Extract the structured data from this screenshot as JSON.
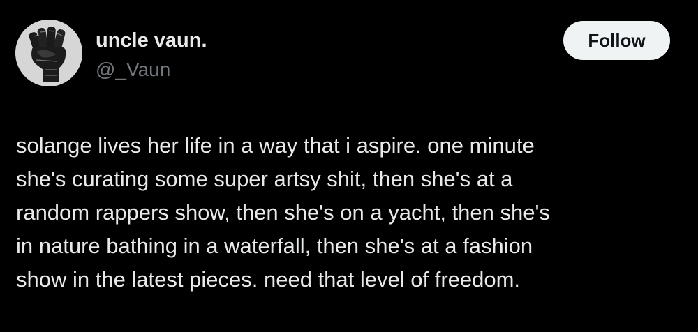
{
  "author": {
    "display_name": "uncle vaun.",
    "handle": "@_Vaun",
    "avatar_icon": "raised-fist-icon"
  },
  "follow_button": {
    "label": "Follow"
  },
  "tweet": {
    "lines": [
      "solange lives her life in a way that i aspire. one minute",
      "she's curating some super artsy shit, then she's at a",
      "random rappers show, then she's on a yacht, then she's",
      "in nature bathing in a waterfall, then she's at a fashion",
      "show in the latest pieces. need that level of freedom."
    ]
  },
  "colors": {
    "background": "#000000",
    "text_primary": "#e7e9ea",
    "text_secondary": "#71767b",
    "follow_bg": "#eff3f4",
    "follow_text": "#0f1419"
  }
}
